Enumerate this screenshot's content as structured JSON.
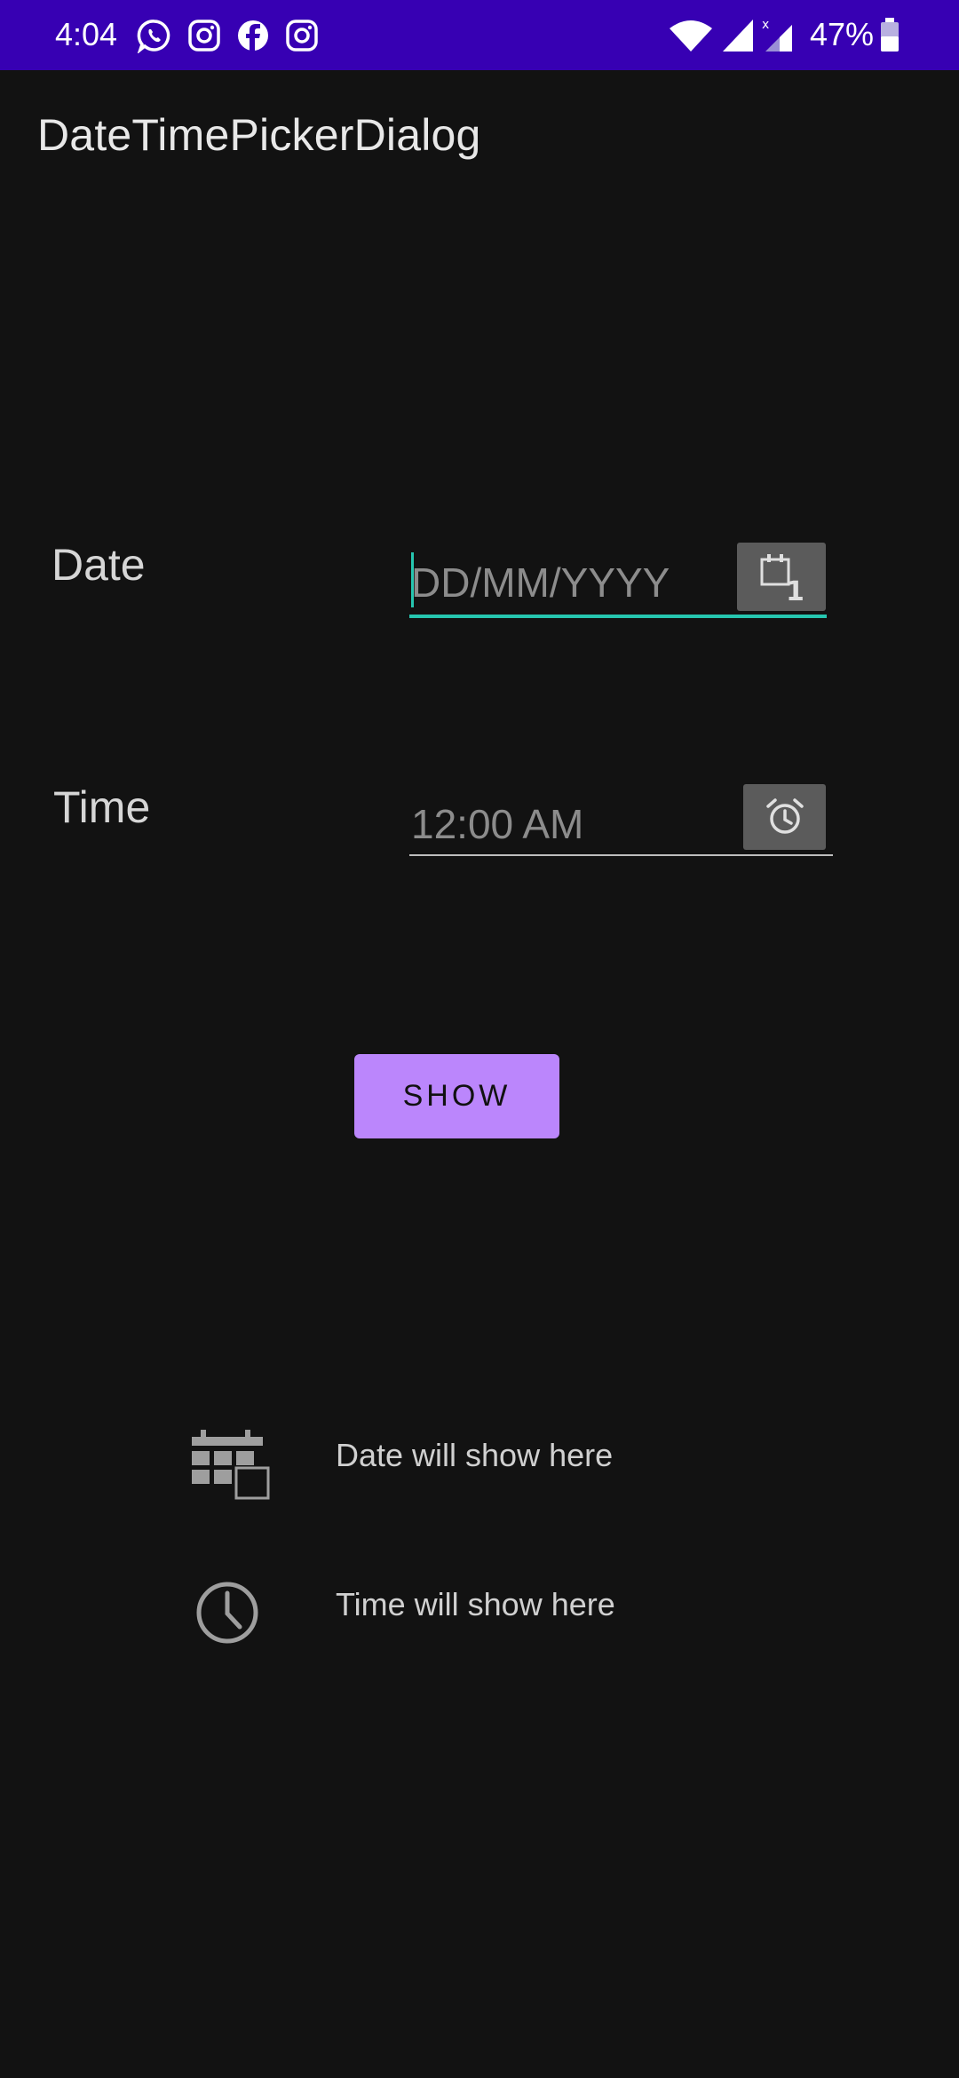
{
  "status_bar": {
    "time": "4:04",
    "notification_icons": [
      "whatsapp-icon",
      "instagram-icon",
      "facebook-icon",
      "instagram-icon"
    ],
    "battery_percent": "47%",
    "color": "#3700b3"
  },
  "app_bar": {
    "title": "DateTimePickerDialog"
  },
  "date_row": {
    "label": "Date",
    "placeholder": "DD/MM/YYYY",
    "value": "",
    "button_icon": "calendar-icon",
    "focused": true
  },
  "time_row": {
    "label": "Time",
    "placeholder": "12:00 AM",
    "value": "",
    "button_icon": "alarm-clock-icon"
  },
  "show_button": {
    "label": "SHOW",
    "color": "#bb86fc"
  },
  "results": {
    "date_text": "Date will show here",
    "date_icon": "calendar-grid-icon",
    "time_text": "Time will show here",
    "time_icon": "clock-icon"
  },
  "colors": {
    "accent": "#26c6b0",
    "background": "#121212"
  }
}
